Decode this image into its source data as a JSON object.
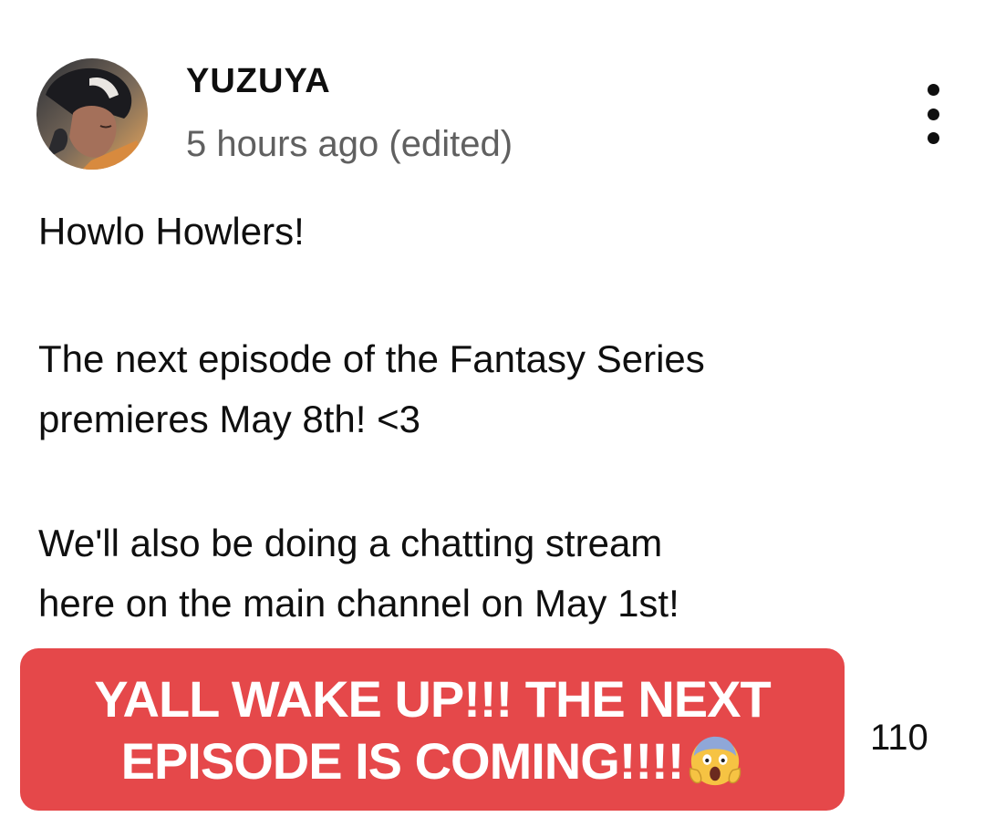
{
  "post": {
    "author": "YUZUYA",
    "timestamp": "5 hours ago (edited)",
    "avatar_icon": "channel-avatar",
    "menu_icon": "more-vertical-icon",
    "body": {
      "greeting": "Howlo Howlers!",
      "line2a": "The next episode of the Fantasy Series",
      "line2b": "premieres May 8th! <3",
      "line3a": "We'll also be doing a chatting stream",
      "line3b": "here on the main channel on May 1st!"
    },
    "like_count": "110"
  },
  "overlay_caption": {
    "line1": "YALL WAKE UP!!! THE NEXT",
    "line2": "EPISODE IS COMING!!!!",
    "emoji": "screaming-face-emoji",
    "background_color": "#e5484a"
  }
}
